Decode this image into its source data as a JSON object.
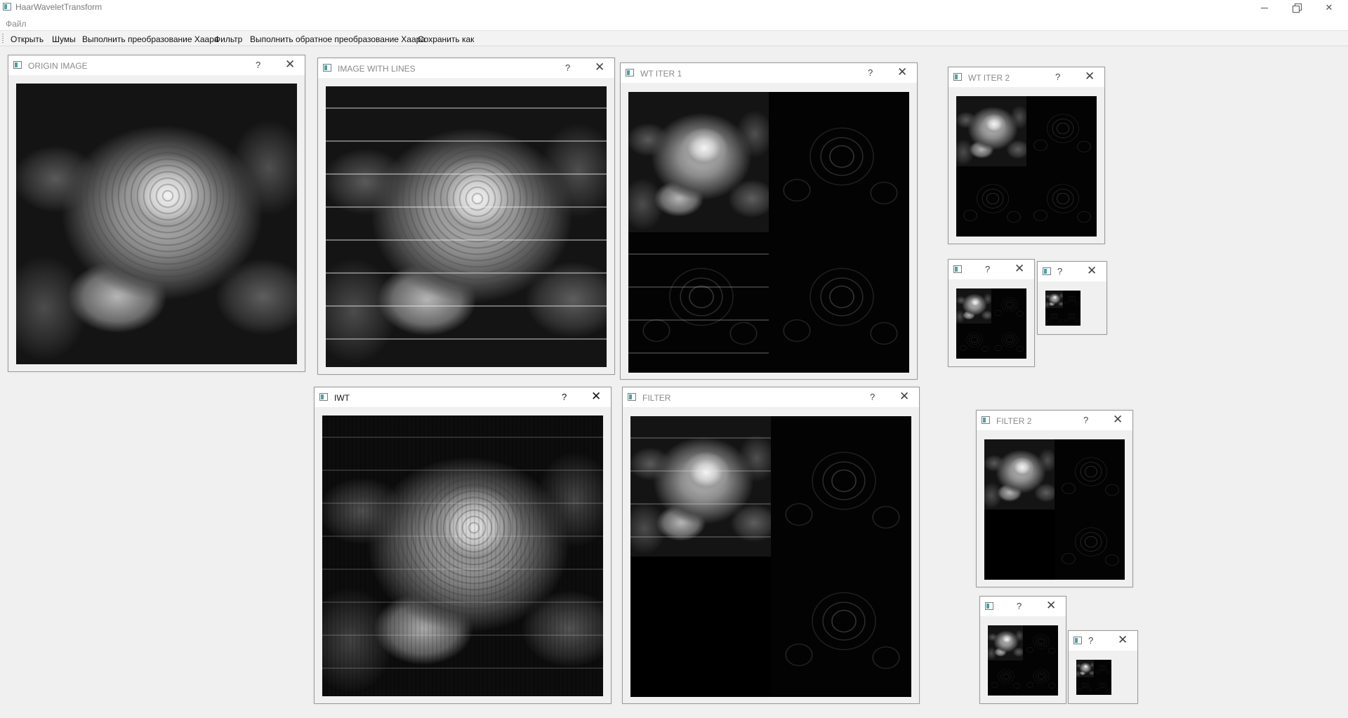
{
  "app": {
    "title": "HaarWaveletTransform",
    "icon": "app-window-icon"
  },
  "menubar": {
    "items": [
      {
        "label": "Файл"
      }
    ]
  },
  "toolbar": {
    "open_label": "Открыть",
    "noise_label": "Шумы",
    "haar_label": "Выполнить преобразование Хаара",
    "filter_label": "Фильтр",
    "inverse_haar_label": "Выполнить обратное преобразование Хаара",
    "save_as_label": "Сохранить как"
  },
  "subwindows": {
    "origin": {
      "title": "ORIGIN IMAGE",
      "help": "?",
      "close": "✕"
    },
    "lines": {
      "title": "IMAGE WITH LINES",
      "help": "?",
      "close": "✕"
    },
    "wt1": {
      "title": "WT ITER 1",
      "help": "?",
      "close": "✕"
    },
    "wt2": {
      "title": "WT ITER 2",
      "help": "?",
      "close": "✕"
    },
    "wt3": {
      "title": "",
      "help": "?",
      "close": "✕"
    },
    "wt4": {
      "title": "",
      "help": "?",
      "close": "✕"
    },
    "iwt": {
      "title": "IWT",
      "help": "?",
      "close": "✕"
    },
    "filter": {
      "title": "FILTER",
      "help": "?",
      "close": "✕"
    },
    "filter2": {
      "title": "FILTER 2",
      "help": "?",
      "close": "✕"
    },
    "filter3": {
      "title": "",
      "help": "?",
      "close": "✕"
    },
    "filter4": {
      "title": "",
      "help": "?",
      "close": "✕"
    }
  },
  "colors": {
    "workspace": "#f0f0f0",
    "title_inactive": "#8a8a8a",
    "title_active": "#111111",
    "icon_accent": "#4aa0a8"
  }
}
